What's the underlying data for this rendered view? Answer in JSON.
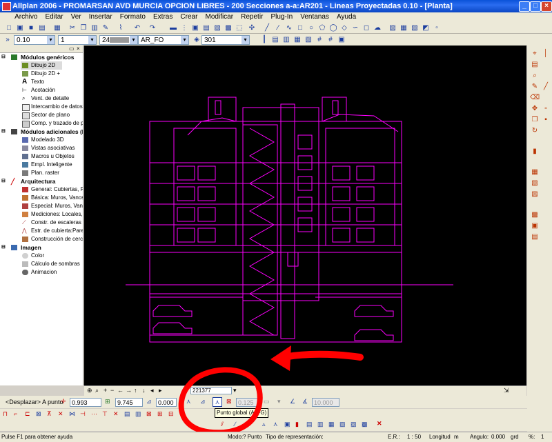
{
  "window": {
    "title": "Allplan 2006 - PROMARSAN AVD MURCIA OPCION LIBRES - 200 Secciones a-a:AR201 - Lineas Proyectadas 0.10 - [Planta]"
  },
  "menu": [
    "Archivo",
    "Editar",
    "Ver",
    "Insertar",
    "Formato",
    "Extras",
    "Crear",
    "Modificar",
    "Repetir",
    "Plug-In",
    "Ventanas",
    "Ayuda"
  ],
  "format_bar": {
    "pen": "0.10",
    "line": "1",
    "color": "24",
    "layer": "AR_FO",
    "pattern": "301"
  },
  "tree": {
    "groups": [
      {
        "label": "Módulos genéricos",
        "items": [
          "Dibujo 2D",
          "Dibujo 2D +",
          "Texto",
          "Acotación",
          "Vent. de detalle",
          "Intercambio de datos",
          "Sector de plano",
          "Comp. y trazado de plan"
        ]
      },
      {
        "label": "Módulos adicionales (I)",
        "items": [
          "Modelado 3D",
          "Vistas asociativas",
          "Macros u Objetos",
          "Empl. Inteligente",
          "Plan. raster"
        ]
      },
      {
        "label": "Arquitectura",
        "items": [
          "General: Cubiertas, Plan",
          "Básica: Muros, Vanos, E",
          "Especial: Muros, Vanos,",
          "Mediciones: Locales, Su",
          "Constr. de escaleras",
          "Estr. de cubierta:Pares,",
          "Construcción de cercha"
        ]
      },
      {
        "label": "Imagen",
        "items": [
          "Color",
          "Cálculo de sombras",
          "Animacion"
        ]
      }
    ],
    "selected": "Dibujo 2D"
  },
  "nav_bar": {
    "zoom_value": "221377"
  },
  "coord_bar": {
    "prompt": "<Desplazar> A punto",
    "dx": "0.993",
    "dy": "9.745",
    "dz": "0.000",
    "disabled_value": "0.125",
    "disabled_value2": "10.000"
  },
  "tooltip": "Punto global (Alt+G)",
  "status": {
    "help": "Pulse F1 para obtener ayuda",
    "mode_label": "Modo:",
    "mode_value": "? Punto",
    "repr_label": "Tipo de representación:",
    "scale_label": "E.R.:",
    "scale_value": "1 : 50",
    "length_label": "Longitud",
    "length_value": "m",
    "angle_label": "Angulo:",
    "angle_value": "0.000",
    "unit_value": "grd",
    "percent_label": "%:",
    "percent_value": "1"
  },
  "colors": {
    "drawing": "#ff00ff",
    "annotation": "#ff0000",
    "canvas": "#000000",
    "titlebar": "#0a52d8"
  }
}
